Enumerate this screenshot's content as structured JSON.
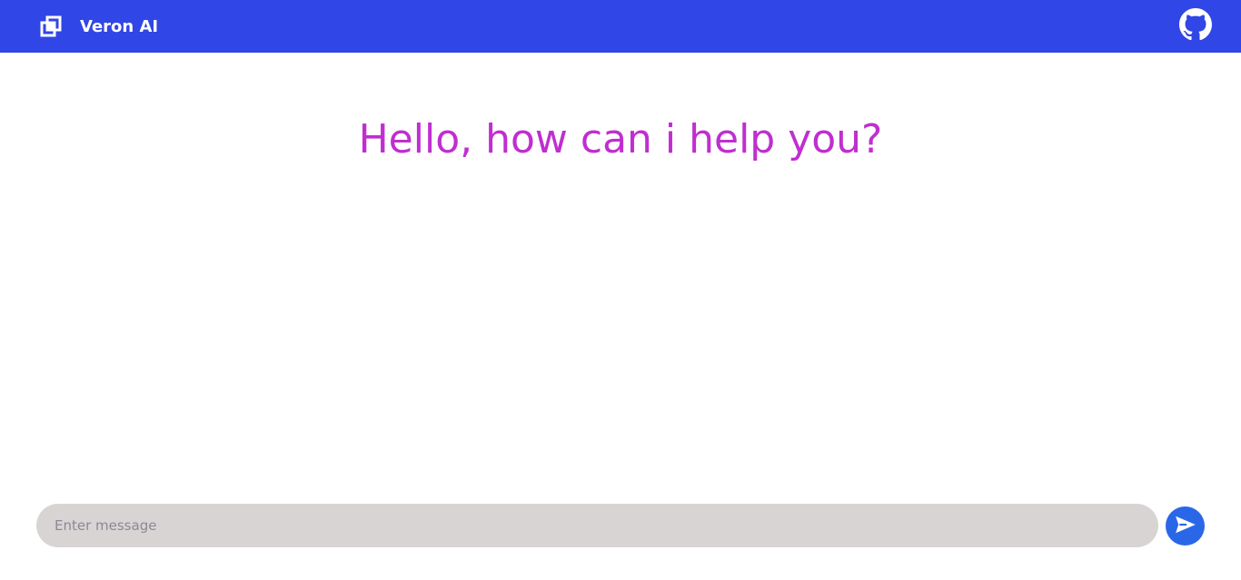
{
  "header": {
    "app_name": "Veron AI",
    "logo_icon": "layers-logo-icon",
    "github_icon": "github-icon",
    "background_color": "#3146e6"
  },
  "main": {
    "greeting": "Hello, how can i help you?",
    "greeting_color": "#c02ed0"
  },
  "composer": {
    "placeholder": "Enter message",
    "value": "",
    "send_icon": "send-icon",
    "send_button_color": "#2a67e8",
    "input_background": "#d8d4d4"
  }
}
